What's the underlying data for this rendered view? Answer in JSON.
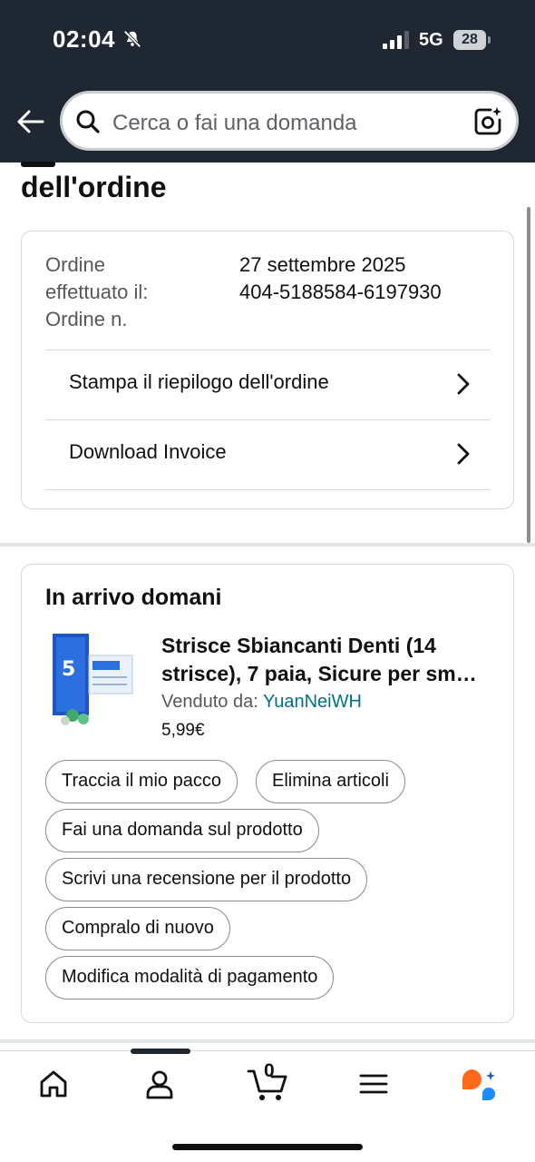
{
  "status_bar": {
    "time": "02:04",
    "network": "5G",
    "battery": "28"
  },
  "search": {
    "placeholder": "Cerca o fai una domanda"
  },
  "page": {
    "title": "dell'ordine"
  },
  "order_info": {
    "placed_label": "Ordine\neffettuato il:",
    "placed_label_line1": "Ordine",
    "placed_label_line2": "effettuato il:",
    "number_label": "Ordine n.",
    "date": "27 settembre 2025",
    "number": "404-5188584-6197930"
  },
  "order_links": [
    {
      "label": "Stampa il riepilogo dell'ordine"
    },
    {
      "label": "Download Invoice"
    }
  ],
  "shipment": {
    "heading": "In arrivo domani",
    "product": {
      "title_line1": "Strisce Sbiancanti Denti (14",
      "title_line2": "strisce), 7 paia, Sicure per sm…",
      "seller_label": "Venduto da: ",
      "seller_name": "YuanNeiWH",
      "price": "5,99€"
    },
    "actions": [
      "Traccia il mio pacco",
      "Elimina articoli",
      "Fai una domanda sul prodotto",
      "Scrivi una recensione per il prodotto",
      "Compralo di nuovo",
      "Modifica modalità di pagamento"
    ]
  },
  "bottom_nav": {
    "cart_count": "0",
    "items": [
      "home-icon",
      "account-icon",
      "cart-icon",
      "menu-icon",
      "rufus-icon"
    ]
  },
  "colors": {
    "header_bg": "#1f2733",
    "link": "#007185",
    "rufus_orange": "#ff6a1a",
    "rufus_blue": "#1a8cff"
  }
}
